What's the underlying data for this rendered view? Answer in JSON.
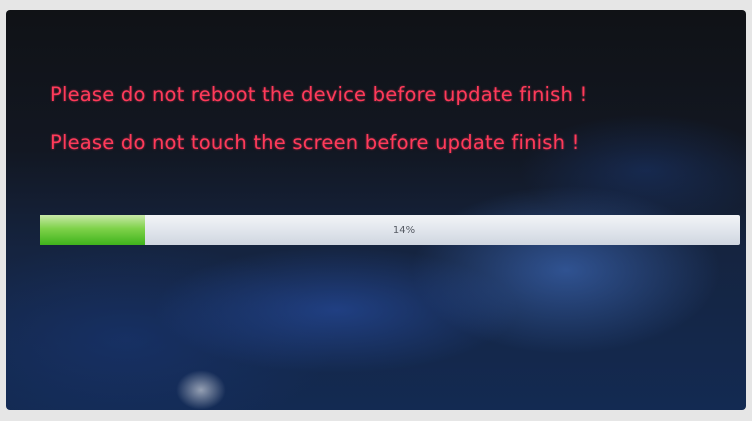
{
  "messages": {
    "line1": "Please do not reboot the device before update finish !",
    "line2": "Please do not touch the screen before update finish !"
  },
  "progress": {
    "label": "14%",
    "value_fraction": 0.15
  },
  "colors": {
    "warning_text": "#ff3a5a",
    "progress_fill": "#5cc22e",
    "progress_track": "#e3e7ee",
    "screen_background": "#132a52"
  }
}
